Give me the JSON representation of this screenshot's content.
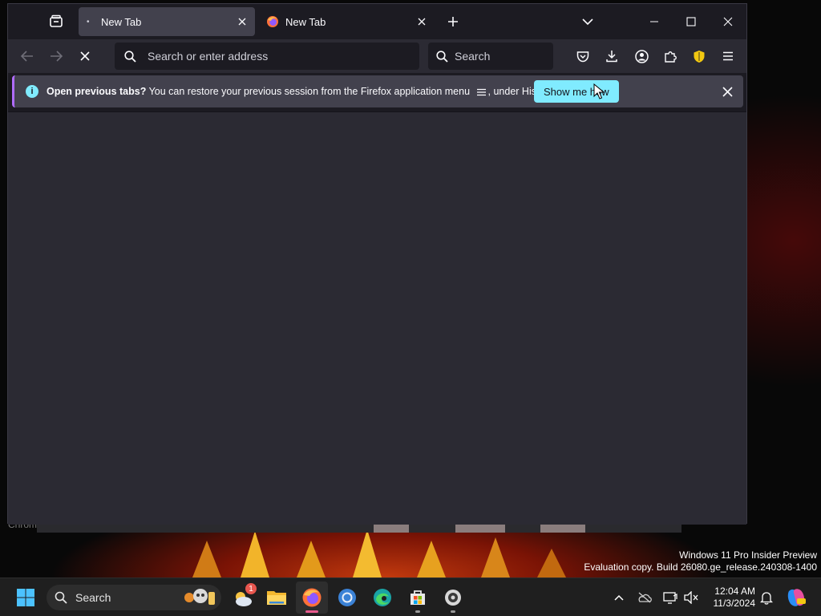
{
  "browser": {
    "tabs": [
      {
        "title": "New Tab",
        "active": true
      },
      {
        "title": "New Tab",
        "active": false
      }
    ],
    "url_placeholder": "Search or enter address",
    "search_placeholder": "Search",
    "notice": {
      "bold_text": "Open previous tabs?",
      "text_before_icon": "You can restore your previous session from the Firefox application menu",
      "text_after_icon": ", under History.",
      "button_label": "Show me how"
    },
    "colors": {
      "accent": "#80ebff",
      "notice_border": "#b06cff",
      "toolbar": "#2b2a33",
      "tabstrip": "#1c1b22"
    }
  },
  "desktop": {
    "watermark_line1": "Windows 11 Pro Insider Preview",
    "watermark_line2": "Evaluation copy. Build 26080.ge_release.240308-1400",
    "fragment_text": "Chrom"
  },
  "taskbar": {
    "search_label": "Search",
    "weather_badge": "1",
    "clock_time": "12:04 AM",
    "clock_date": "11/3/2024",
    "apps": [
      "start-icon",
      "weather-icon",
      "file-explorer-icon",
      "firefox-icon",
      "chrome-icon",
      "edge-icon",
      "store-icon",
      "settings-app-icon"
    ],
    "tray": [
      "chevron-up-icon",
      "onedrive-icon",
      "display-icon",
      "speaker-muted-icon",
      "notification-bell-icon",
      "copilot-icon"
    ]
  }
}
